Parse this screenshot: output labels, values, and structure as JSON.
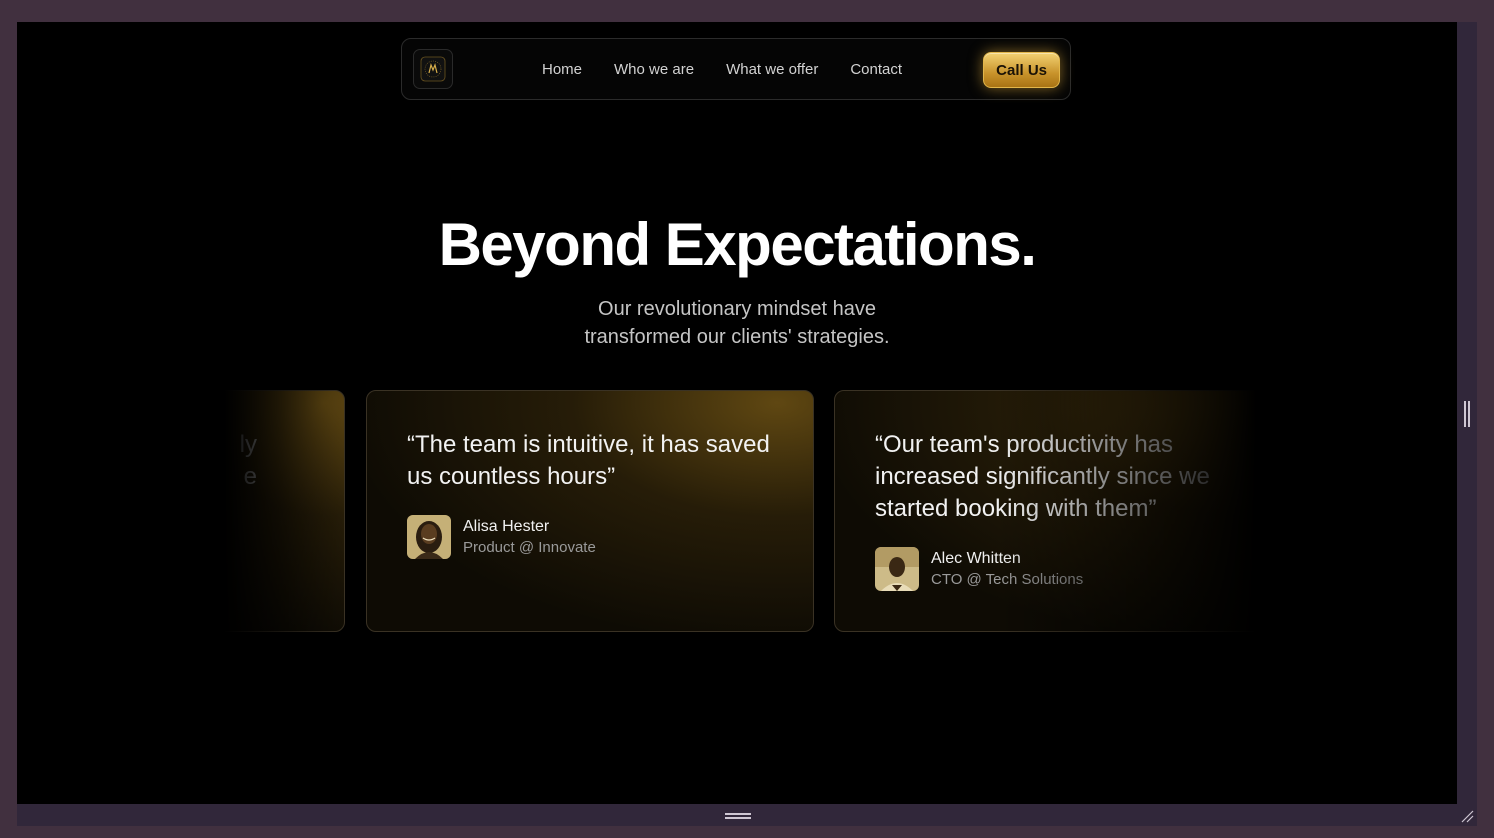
{
  "nav": {
    "logo_icon": "monogram-logo-icon",
    "links": [
      {
        "label": "Home"
      },
      {
        "label": "Who we are"
      },
      {
        "label": "What we offer"
      },
      {
        "label": "Contact"
      }
    ],
    "cta_label": "Call Us"
  },
  "hero": {
    "title": "Beyond Expectations.",
    "subtitle_line1": "Our revolutionary mindset have",
    "subtitle_line2": "transformed our clients' strategies."
  },
  "testimonials": [
    {
      "quote_fragment_1": "ly",
      "quote_fragment_2": "e"
    },
    {
      "quote": "“The team is intuitive, it has saved us countless hours”",
      "name": "Alisa Hester",
      "role": "Product @ Innovate"
    },
    {
      "quote": "“Our team's productivity has increased significantly since we started booking with them”",
      "name": "Alec Whitten",
      "role": "CTO @ Tech Solutions"
    }
  ],
  "colors": {
    "accent_gold": "#e2b64a",
    "background": "#000000",
    "frame": "#41303f"
  }
}
